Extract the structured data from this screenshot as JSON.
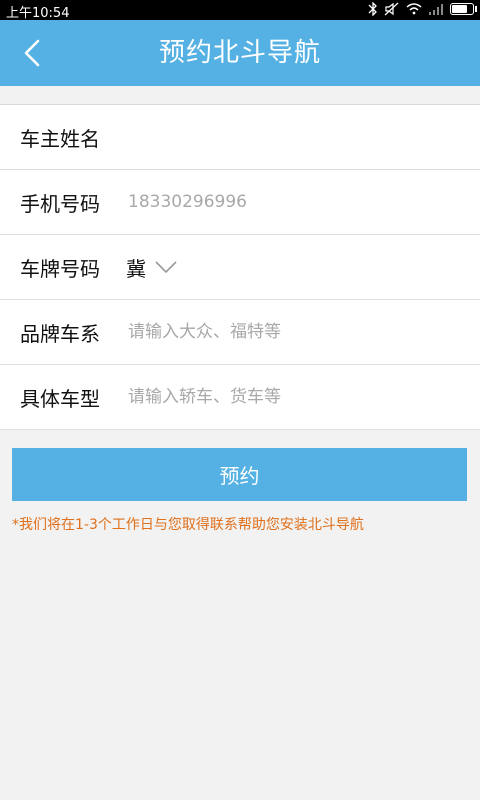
{
  "status_bar": {
    "time": "上午10:54",
    "icons": [
      "bluetooth-icon",
      "mute-icon",
      "wifi-icon",
      "signal-icon",
      "battery-icon"
    ],
    "battery_level": 0.85
  },
  "header": {
    "title": "预约北斗导航",
    "back_icon": "chevron-left-icon",
    "bg_color": "#55b1e3"
  },
  "form": {
    "owner_name": {
      "label": "车主姓名",
      "value": "",
      "placeholder": ""
    },
    "phone": {
      "label": "手机号码",
      "value": "",
      "placeholder": "18330296996"
    },
    "plate": {
      "label": "车牌号码",
      "province": "冀",
      "dropdown_icon": "chevron-down-icon"
    },
    "brand": {
      "label": "品牌车系",
      "value": "",
      "placeholder": "请输入大众、福特等"
    },
    "model": {
      "label": "具体车型",
      "value": "",
      "placeholder": "请输入轿车、货车等"
    }
  },
  "submit_label": "预约",
  "note": "*我们将在1-3个工作日与您取得联系帮助您安装北斗导航",
  "colors": {
    "accent": "#55b1e3",
    "note": "#e0701b"
  }
}
